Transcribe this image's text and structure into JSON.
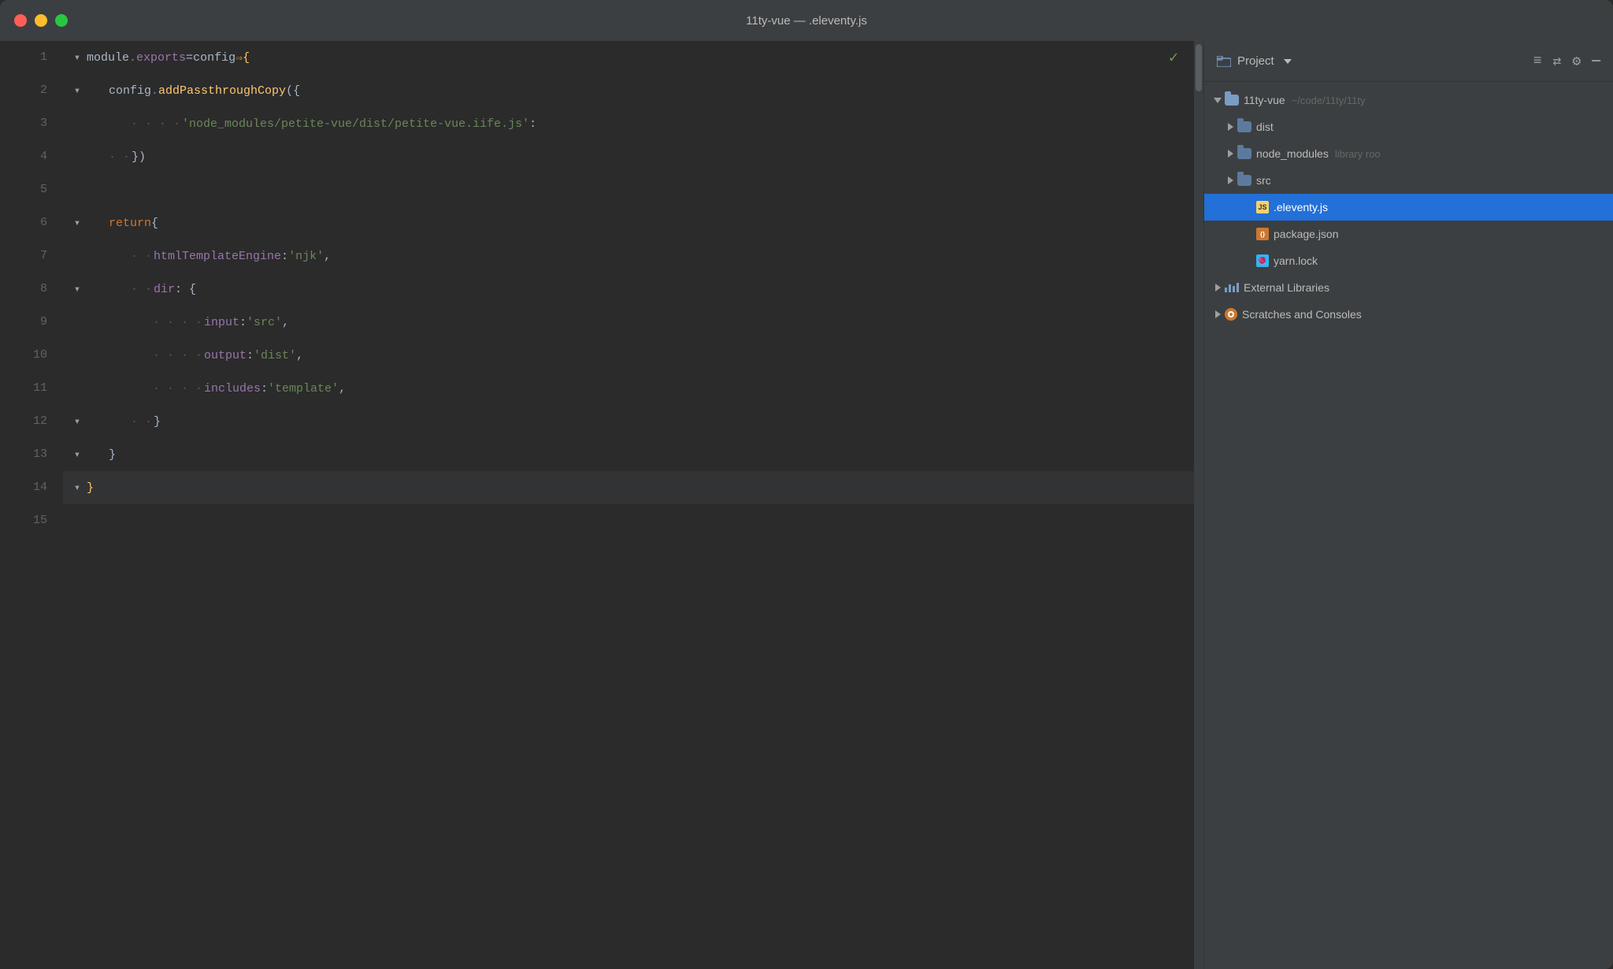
{
  "window": {
    "title": "11ty-vue — .eleventy.js"
  },
  "titlebar": {
    "buttons": [
      "close",
      "minimize",
      "maximize"
    ]
  },
  "editor": {
    "lines": [
      {
        "number": 1,
        "indent": 0,
        "foldable": true,
        "tokens": [
          {
            "text": "module",
            "class": "kw-white"
          },
          {
            "text": ".",
            "class": "kw-gray"
          },
          {
            "text": "exports",
            "class": "kw-purple"
          },
          {
            "text": " = ",
            "class": "kw-white"
          },
          {
            "text": "config",
            "class": "kw-white"
          },
          {
            "text": " ⇒ ",
            "class": "kw-orange"
          },
          {
            "text": "{",
            "class": "kw-yellow"
          }
        ]
      },
      {
        "number": 2,
        "indent": 1,
        "foldable": true,
        "tokens": [
          {
            "text": "config",
            "class": "kw-white"
          },
          {
            "text": ".",
            "class": "kw-gray"
          },
          {
            "text": "addPassthroughCopy",
            "class": "kw-yellow"
          },
          {
            "text": " ({",
            "class": "kw-white"
          }
        ]
      },
      {
        "number": 3,
        "indent": 2,
        "foldable": false,
        "tokens": [
          {
            "text": "'node_modules/petite-vue/dist/petite-vue.iife.js'",
            "class": "kw-green"
          },
          {
            "text": ":",
            "class": "kw-white"
          }
        ]
      },
      {
        "number": 4,
        "indent": 1,
        "foldable": false,
        "tokens": [
          {
            "text": "})",
            "class": "kw-white"
          }
        ]
      },
      {
        "number": 5,
        "indent": 0,
        "foldable": false,
        "tokens": []
      },
      {
        "number": 6,
        "indent": 1,
        "foldable": true,
        "tokens": [
          {
            "text": "return",
            "class": "kw-orange"
          },
          {
            "text": " {",
            "class": "kw-white"
          }
        ]
      },
      {
        "number": 7,
        "indent": 2,
        "foldable": false,
        "tokens": [
          {
            "text": "htmlTemplateEngine",
            "class": "kw-purple"
          },
          {
            "text": ": ",
            "class": "kw-white"
          },
          {
            "text": "'njk'",
            "class": "kw-green"
          },
          {
            "text": ",",
            "class": "kw-white"
          }
        ]
      },
      {
        "number": 8,
        "indent": 2,
        "foldable": true,
        "tokens": [
          {
            "text": "dir",
            "class": "kw-purple"
          },
          {
            "text": ": {",
            "class": "kw-white"
          }
        ]
      },
      {
        "number": 9,
        "indent": 3,
        "foldable": false,
        "tokens": [
          {
            "text": "input",
            "class": "kw-purple"
          },
          {
            "text": ": ",
            "class": "kw-white"
          },
          {
            "text": "'src'",
            "class": "kw-green"
          },
          {
            "text": ",",
            "class": "kw-white"
          }
        ]
      },
      {
        "number": 10,
        "indent": 3,
        "foldable": false,
        "tokens": [
          {
            "text": "output",
            "class": "kw-purple"
          },
          {
            "text": ": ",
            "class": "kw-white"
          },
          {
            "text": "'dist'",
            "class": "kw-green"
          },
          {
            "text": ",",
            "class": "kw-white"
          }
        ]
      },
      {
        "number": 11,
        "indent": 3,
        "foldable": false,
        "tokens": [
          {
            "text": "includes",
            "class": "kw-purple"
          },
          {
            "text": ": ",
            "class": "kw-white"
          },
          {
            "text": "'template'",
            "class": "kw-green"
          },
          {
            "text": ",",
            "class": "kw-white"
          }
        ]
      },
      {
        "number": 12,
        "indent": 2,
        "foldable": true,
        "tokens": [
          {
            "text": "}",
            "class": "kw-white"
          }
        ]
      },
      {
        "number": 13,
        "indent": 1,
        "foldable": true,
        "tokens": [
          {
            "text": "}",
            "class": "kw-white"
          }
        ]
      },
      {
        "number": 14,
        "indent": 0,
        "foldable": true,
        "tokens": [
          {
            "text": "}",
            "class": "kw-yellow"
          },
          {
            "text": "",
            "class": ""
          }
        ],
        "highlighted": true
      },
      {
        "number": 15,
        "indent": 0,
        "foldable": false,
        "tokens": []
      }
    ]
  },
  "sidebar": {
    "title": "Project",
    "root": {
      "name": "11ty-vue",
      "path": "~/code/11ty/11ty",
      "expanded": true,
      "children": [
        {
          "type": "folder",
          "name": "dist",
          "expanded": false
        },
        {
          "type": "folder",
          "name": "node_modules",
          "badge": "library root",
          "expanded": false
        },
        {
          "type": "folder",
          "name": "src",
          "expanded": false
        },
        {
          "type": "file",
          "name": ".eleventy.js",
          "fileType": "js",
          "selected": true
        },
        {
          "type": "file",
          "name": "package.json",
          "fileType": "json"
        },
        {
          "type": "file",
          "name": "yarn.lock",
          "fileType": "yarn"
        }
      ]
    },
    "external_libraries": {
      "name": "External Libraries",
      "expanded": false
    },
    "scratches": {
      "name": "Scratches and Consoles",
      "expanded": false
    }
  }
}
